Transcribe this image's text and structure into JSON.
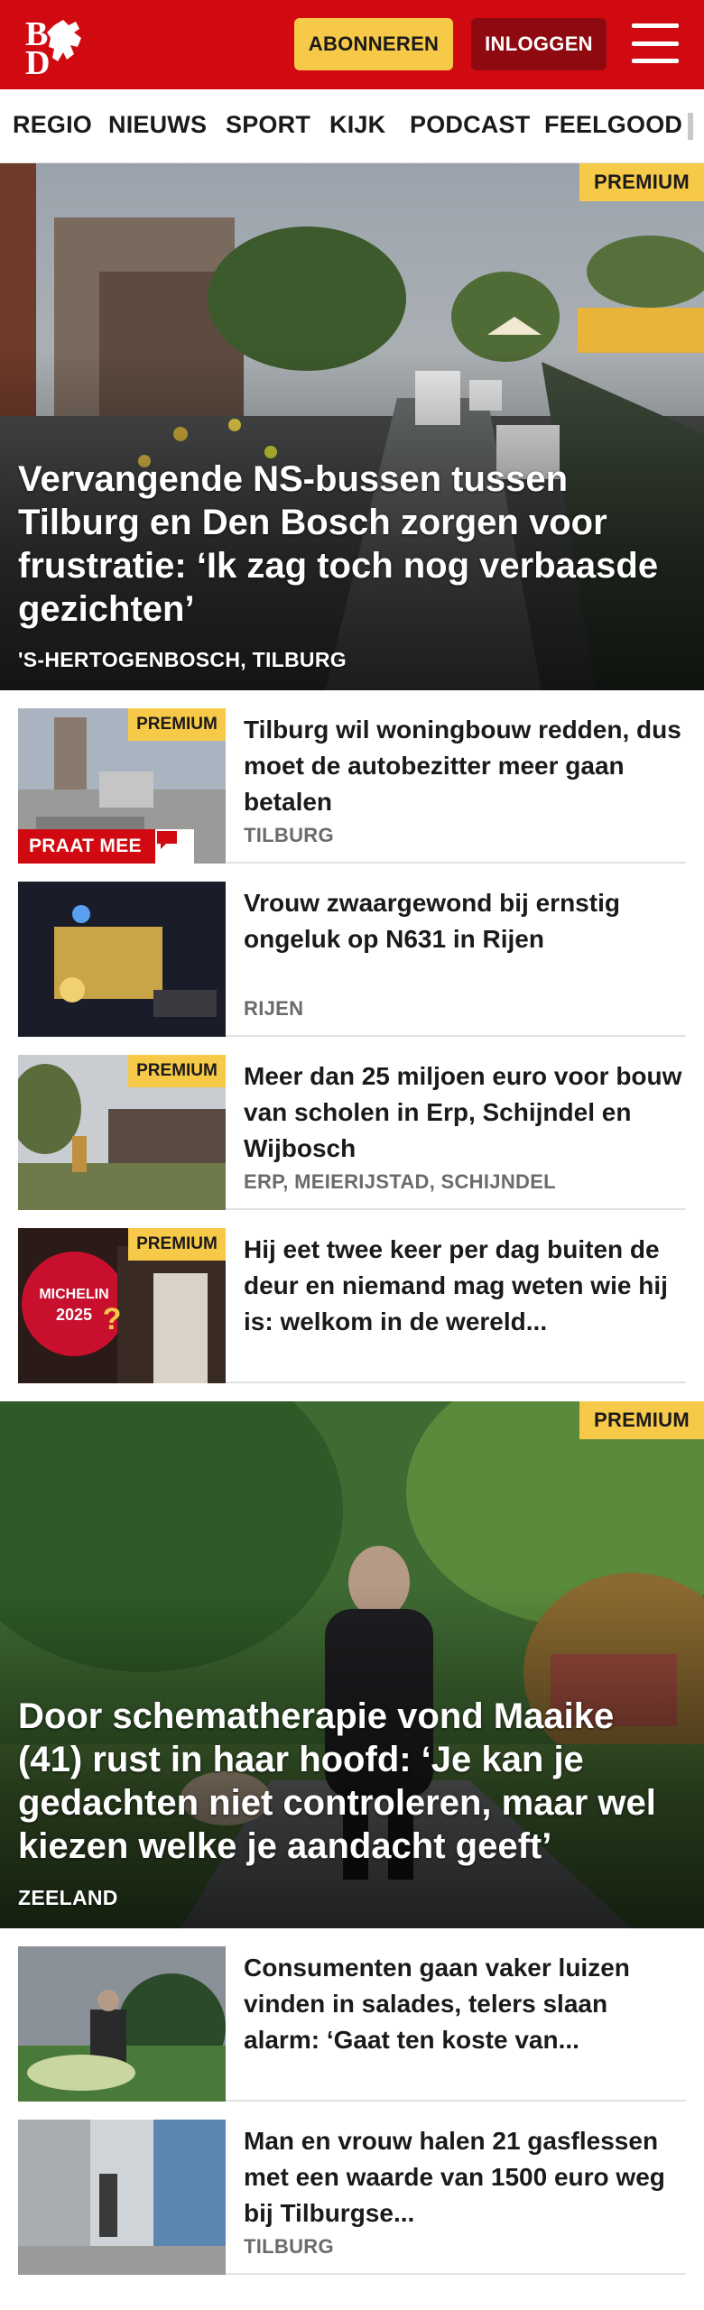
{
  "brand": {
    "logo_text_b": "B",
    "logo_text_d": "D",
    "accent_color": "#d10a11",
    "premium_color": "#f7c948"
  },
  "header": {
    "subscribe_label": "ABONNEREN",
    "login_label": "INLOGGEN",
    "menu_icon": "hamburger-menu-icon"
  },
  "nav": {
    "items": [
      {
        "label": "REGIO"
      },
      {
        "label": "NIEUWS"
      },
      {
        "label": "SPORT"
      },
      {
        "label": "KIJK"
      },
      {
        "label": "PODCAST"
      },
      {
        "label": "FEELGOOD"
      }
    ]
  },
  "hero1": {
    "badge": "PREMIUM",
    "title": "Vervangende NS-bussen tussen Tilburg en Den Bosch zorgen voor frustratie: ‘Ik zag toch nog verbaasde gezichten’",
    "location": "'S-HERTOGENBOSCH, TILBURG"
  },
  "articles": [
    {
      "badge": "PREMIUM",
      "praat_mee": "PRAAT MEE",
      "comment_icon": "comment-icon",
      "title": "Tilburg wil woningbouw redden, dus moet de autobezitter meer gaan betalen",
      "location": "TILBURG"
    },
    {
      "title": "Vrouw zwaargewond bij ernstig ongeluk op N631 in Rijen",
      "location": "RIJEN"
    },
    {
      "badge": "PREMIUM",
      "title": "Meer dan 25 miljoen euro voor bouw van scholen in Erp, Schijndel en Wijbosch",
      "location": "ERP, MEIERIJSTAD, SCHIJNDEL"
    },
    {
      "badge": "PREMIUM",
      "thumb_text": "MICHELIN 2025",
      "title": "Hij eet twee keer per dag buiten de deur en niemand mag weten wie hij is: welkom in de wereld...",
      "location": ""
    }
  ],
  "hero2": {
    "badge": "PREMIUM",
    "title": "Door schematherapie vond Maaike (41) rust in haar hoofd: ‘Je kan je gedachten niet controleren, maar wel kiezen welke je aandacht geeft’",
    "location": "ZEELAND"
  },
  "articles2": [
    {
      "title": "Consumenten gaan vaker luizen vinden in salades, telers slaan alarm: ‘Gaat ten koste van...",
      "location": ""
    },
    {
      "title": "Man en vrouw halen 21 gasflessen met een waarde van 1500 euro weg bij Tilburgse...",
      "location": "TILBURG"
    }
  ]
}
